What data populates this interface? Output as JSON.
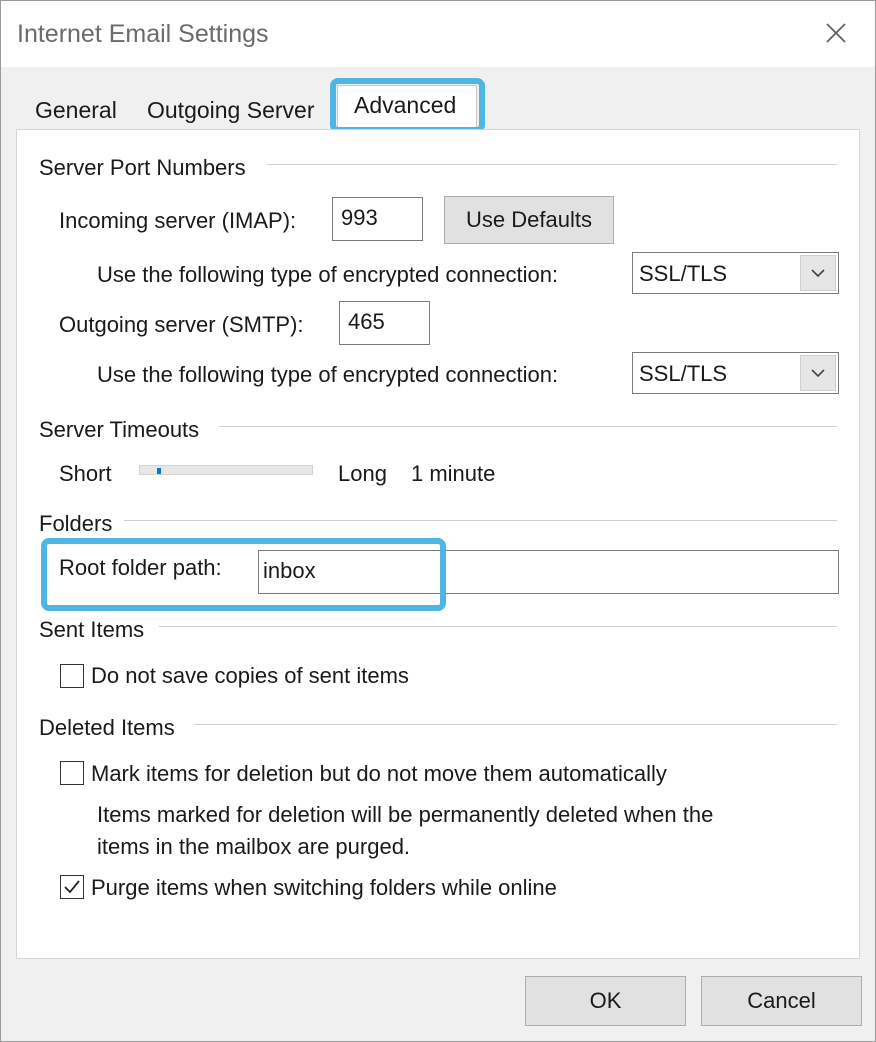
{
  "window": {
    "title": "Internet Email Settings",
    "close_icon": "close-icon"
  },
  "tabs": [
    {
      "label": "General"
    },
    {
      "label": "Outgoing Server"
    },
    {
      "label": "Advanced",
      "active": true
    }
  ],
  "server_ports": {
    "group_title": "Server Port Numbers",
    "incoming_label": "Incoming server (IMAP):",
    "incoming_value": "993",
    "use_defaults_label": "Use Defaults",
    "incoming_encryption_label": "Use the following type of encrypted connection:",
    "incoming_encryption_value": "SSL/TLS",
    "outgoing_label": "Outgoing server (SMTP):",
    "outgoing_value": "465",
    "outgoing_encryption_label": "Use the following type of encrypted connection:",
    "outgoing_encryption_value": "SSL/TLS"
  },
  "timeouts": {
    "group_title": "Server Timeouts",
    "short_label": "Short",
    "long_label": "Long",
    "value_label": "1 minute",
    "slider_level": 0.1
  },
  "folders": {
    "group_title": "Folders",
    "root_label": "Root folder path:",
    "root_value": "inbox"
  },
  "sent_items": {
    "group_title": "Sent Items",
    "no_save_label": "Do not save copies of sent items",
    "no_save_checked": false
  },
  "deleted_items": {
    "group_title": "Deleted Items",
    "mark_label": "Mark items for deletion but do not move them automatically",
    "mark_checked": false,
    "note_line1": "Items marked for deletion will be permanently deleted when the",
    "note_line2": "items in the mailbox are purged.",
    "purge_label": "Purge items when switching folders while online",
    "purge_checked": true
  },
  "footer": {
    "ok_label": "OK",
    "cancel_label": "Cancel"
  },
  "colors": {
    "highlight": "#4fb6e3",
    "slider_thumb": "#0078d7"
  }
}
